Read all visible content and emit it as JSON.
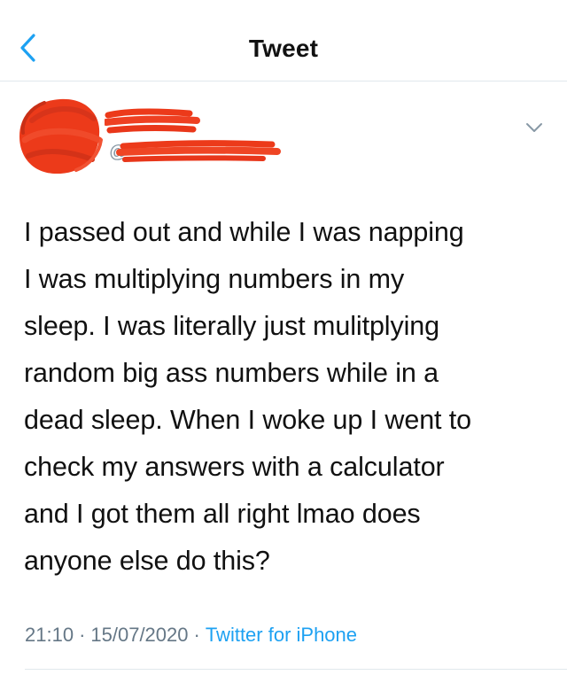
{
  "header": {
    "title": "Tweet",
    "back_icon": "chevron-left-icon"
  },
  "author": {
    "handle_prefix": "@",
    "menu_icon": "chevron-down-icon"
  },
  "tweet": {
    "text": "I passed out and while I was napping\nI was multiplying numbers in my\nsleep. I was literally just mulitplying\nrandom big ass numbers while in a\ndead sleep. When I woke up I went to\ncheck my answers with a calculator\nand I got them all right lmao does\nanyone else do this?",
    "time": "21:10",
    "date": "15/07/2020",
    "separator": "·",
    "source": "Twitter for iPhone"
  },
  "colors": {
    "accent": "#1da1f2",
    "redaction": "#ec3a1a",
    "meta_text": "#657786",
    "divider": "#e1e8ed"
  }
}
